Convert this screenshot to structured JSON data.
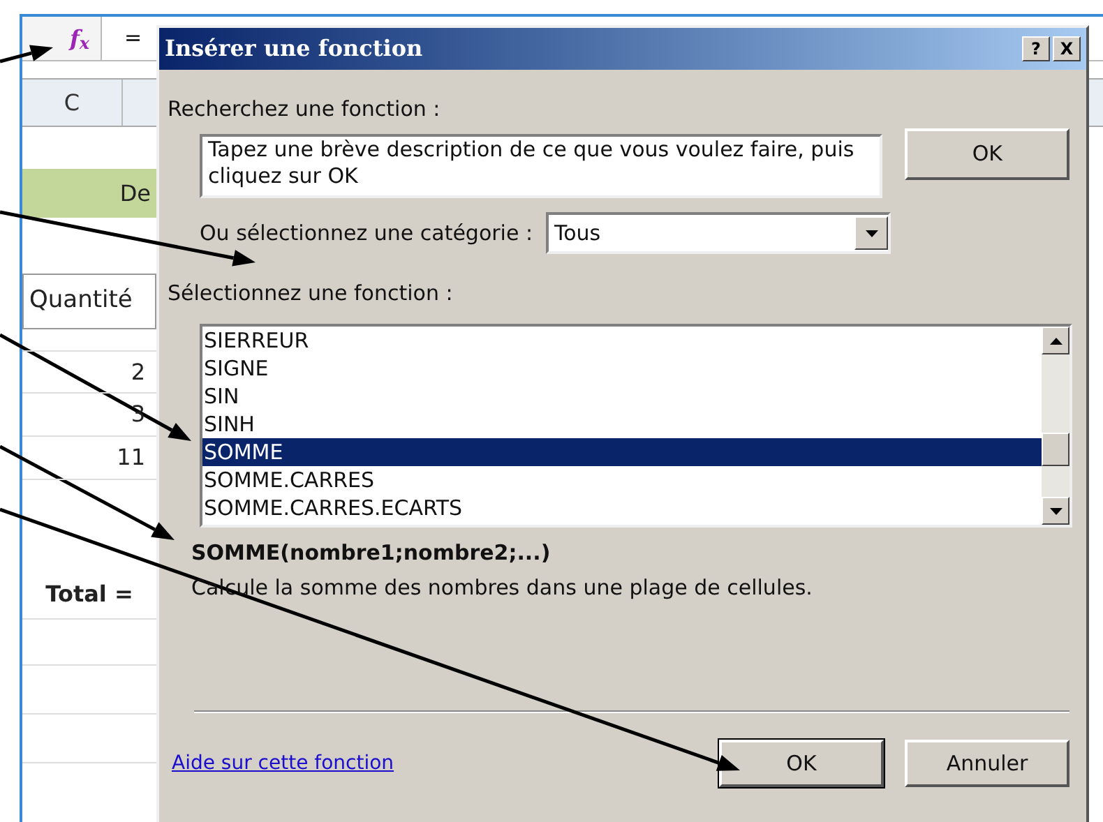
{
  "formula_bar": {
    "fx": "f$_{x}$",
    "content": "="
  },
  "sheet": {
    "column_header": "C",
    "cells": [
      {
        "text": "De",
        "kind": "title"
      },
      {
        "text": "Quantité",
        "kind": "header"
      },
      {
        "text": "2",
        "kind": "number"
      },
      {
        "text": "3",
        "kind": "number"
      },
      {
        "text": "11",
        "kind": "number"
      },
      {
        "text": "Total =",
        "kind": "total"
      }
    ]
  },
  "dialog": {
    "title": "Insérer une fonction",
    "help_button": "?",
    "close_button": "X",
    "search_label": "Recherchez une fonction :",
    "search_value": "Tapez une brève description de ce que vous voulez faire, puis cliquez sur OK",
    "search_button": "OK",
    "category_label": "Ou sélectionnez une catégorie :",
    "category_value": "Tous",
    "list_label": "Sélectionnez une fonction :",
    "functions": [
      {
        "name": "SIERREUR",
        "selected": false
      },
      {
        "name": "SIGNE",
        "selected": false
      },
      {
        "name": "SIN",
        "selected": false
      },
      {
        "name": "SINH",
        "selected": false
      },
      {
        "name": "SOMME",
        "selected": true
      },
      {
        "name": "SOMME.CARRES",
        "selected": false
      },
      {
        "name": "SOMME.CARRES.ECARTS",
        "selected": false
      }
    ],
    "signature": "SOMME(nombre1;nombre2;...)",
    "description": "Calcule la somme des nombres dans une plage de cellules.",
    "help_link": "Aide sur cette fonction",
    "buttons": [
      {
        "label": "OK",
        "default": true
      },
      {
        "label": "Annuler",
        "default": false
      }
    ]
  }
}
